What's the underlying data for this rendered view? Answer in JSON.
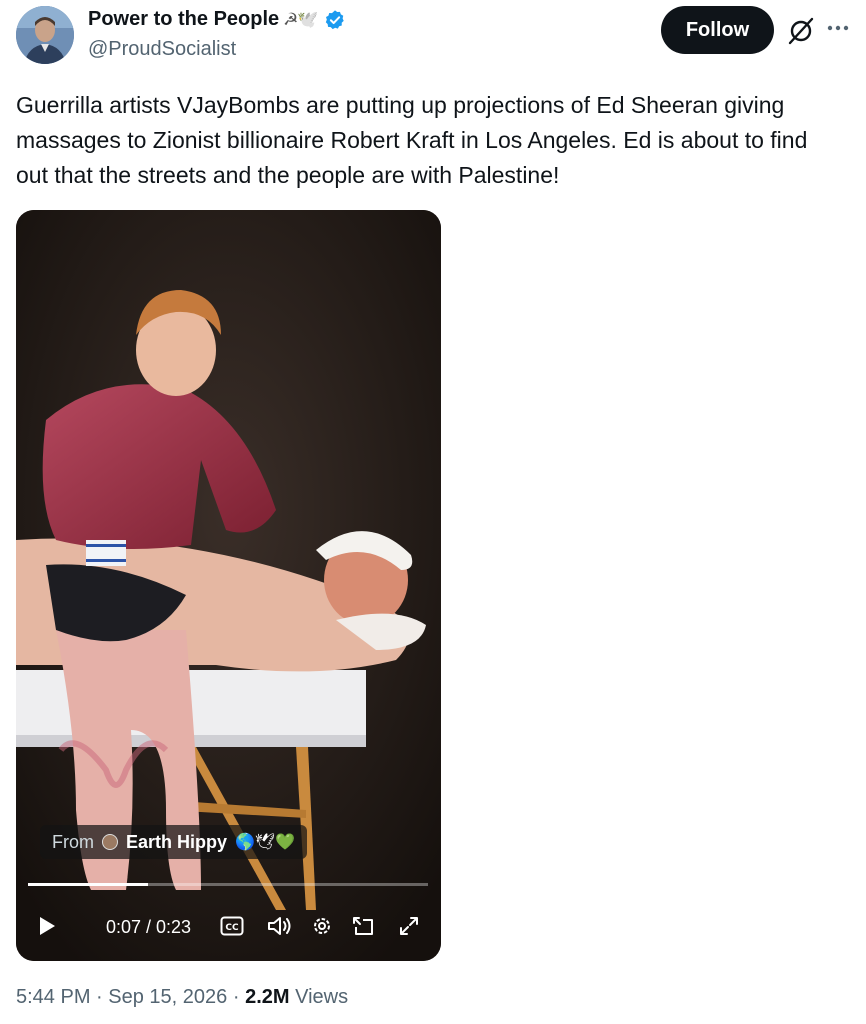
{
  "author": {
    "name": "Power to the People",
    "name_emoji": "☭🕊️",
    "handle": "@ProudSocialist",
    "verified": true
  },
  "header": {
    "follow_label": "Follow"
  },
  "tweet": {
    "text": "Guerrilla artists VJayBombs are putting up projections of Ed Sheeran giving massages to Zionist billionaire Robert Kraft in Los Angeles. Ed is about to find out that the streets and the people are with Palestine!"
  },
  "video": {
    "from_label": "From",
    "from_name": "Earth Hippy",
    "from_emoji": "🌎🕊💚",
    "time": "0:07 / 0:23",
    "progress_fraction": 0.3
  },
  "footer": {
    "time": "5:44 PM",
    "date": "Sep 15, 2026",
    "views_count": "2.2M",
    "views_label": "Views",
    "separator": "·"
  },
  "colors": {
    "accent_verified": "#1d9bf0",
    "button_bg": "#0f1419",
    "muted_text": "#536471"
  }
}
